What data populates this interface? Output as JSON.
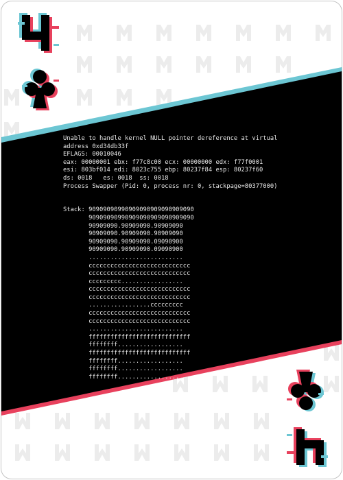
{
  "card": {
    "rank": "4",
    "suit": "club-icon",
    "colors": {
      "ink": "#000000",
      "accent_cyan": "#6cc6d3",
      "accent_red": "#e8415d",
      "watermark": "#ececec",
      "terminal_text": "#e8e8e8"
    }
  },
  "terminal": {
    "lines": [
      "Unable to handle kernel NULL pointer dereference at virtual",
      "address 0xd34db33f",
      "EFLAGS: 00010046",
      "eax: 00000001 ebx: f77c8c00 ecx: 00000000 edx: f77f0001",
      "esi: 803bf014 edi: 8023c755 ebp: 80237f84 esp: 80237f60",
      "ds: 0018   es: 0018  ss: 0018",
      "Process Swapper (Pid: 0, process nr: 0, stackpage=80377000)",
      "",
      "",
      "Stack: 90909090990909090909090909090",
      "       90909090990909090909090909090",
      "       90909090.90909090.90909090",
      "       90909090.90909090.90909090",
      "       90909090.90909090.09090900",
      "       90909090.90909090.09090900",
      "       ..........................",
      "       cccccccccccccccccccccccccccc",
      "       cccccccccccccccccccccccccccc",
      "       ccccccccc.................",
      "       cccccccccccccccccccccccccccc",
      "       cccccccccccccccccccccccccccc",
      "       .................ccccccccc",
      "       cccccccccccccccccccccccccccc",
      "       cccccccccccccccccccccccccccc",
      "       ..........................",
      "       ffffffffffffffffffffffffffff",
      "       ffffffff..................",
      "       ffffffffffffffffffffffffffff",
      "       ffffffff..................",
      "       ffffffff..................",
      "       ffffffff.................."
    ]
  }
}
